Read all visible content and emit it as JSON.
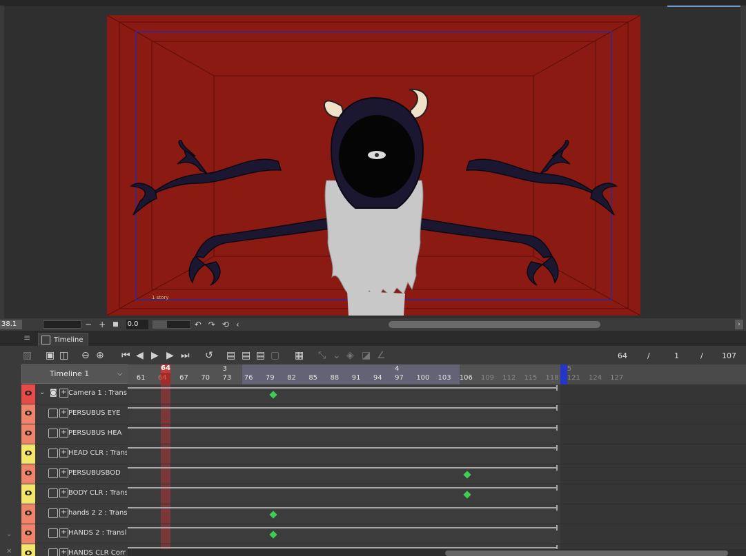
{
  "canvas": {
    "stage_caption": "1 story",
    "colors": {
      "background": "#8b1a13",
      "outline": "#2b2b9a"
    }
  },
  "navigator": {
    "zoom": "38.1",
    "minus": "−",
    "plus": "+",
    "square": "■",
    "rotation": "0.0",
    "rotate_left": "↶",
    "rotate_right": "↷",
    "reset": "⟲",
    "collapse": "‹",
    "expand": "›"
  },
  "panel": {
    "menu": "≡",
    "tab_label": "Timeline"
  },
  "toolbar": {
    "icons": [
      "graph-icon",
      "new-timeline-icon",
      "edit-timeline-icon",
      "zoom-out-icon",
      "zoom-in-icon",
      "first-frame-icon",
      "prev-frame-icon",
      "play-icon",
      "next-frame-icon",
      "last-frame-icon",
      "loop-icon",
      "new-anim-folder-icon",
      "new-cel-icon",
      "specify-cel-icon",
      "delete-cel-icon",
      "onion-skin-icon",
      "pen-key-icon",
      "keyframe-icon",
      "interp-icon",
      "brush-icon"
    ],
    "current_frame": "64",
    "sep1": "/",
    "scene": "1",
    "sep2": "/",
    "total_frames": "107"
  },
  "timeline": {
    "name": "Timeline 1",
    "dropdown": "⌵",
    "current_frame": "64",
    "ticks": [
      "61",
      "64",
      "67",
      "70",
      "73",
      "76",
      "79",
      "82",
      "85",
      "88",
      "91",
      "94",
      "97",
      "100",
      "103",
      "106",
      "109",
      "112",
      "115",
      "118",
      "121",
      "124",
      "127"
    ],
    "scene_markers": [
      "3",
      "4",
      "5"
    ]
  },
  "layers": [
    {
      "label": "Camera 1 : Trans",
      "color": "#e84a4a",
      "keys": [
        79
      ],
      "camera": true
    },
    {
      "label": "PERSUBUS EYE",
      "color": "#f0846a",
      "keys": []
    },
    {
      "label": "PERSUBUS HEA",
      "color": "#f0846a",
      "keys": []
    },
    {
      "label": "HEAD CLR : Trans",
      "color": "#f4e66a",
      "keys": []
    },
    {
      "label": "PERSUBUSBOD",
      "color": "#f0846a",
      "keys": [
        106
      ]
    },
    {
      "label": "BODY CLR : Trans",
      "color": "#f4e66a",
      "keys": [
        106
      ]
    },
    {
      "label": "hands 2 2 : Transl",
      "color": "#f0846a",
      "keys": [
        79
      ]
    },
    {
      "label": "HANDS 2 : Transl",
      "color": "#f0846a",
      "keys": [
        79
      ]
    },
    {
      "label": "HANDS CLR Corr",
      "color": "#f4e66a",
      "keys": []
    }
  ]
}
